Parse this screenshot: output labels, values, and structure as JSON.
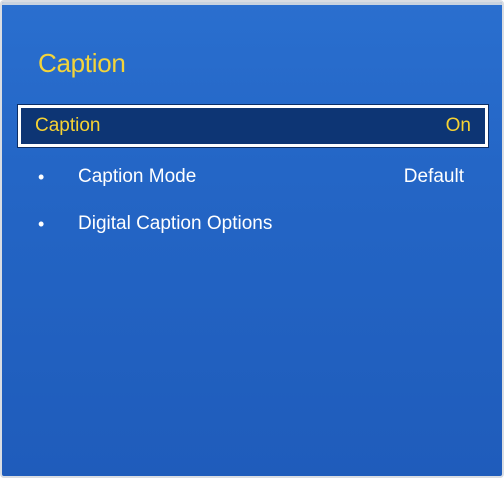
{
  "panel": {
    "title": "Caption"
  },
  "menu": {
    "items": [
      {
        "label": "Caption",
        "value": "On"
      },
      {
        "bullet": "•",
        "label": "Caption Mode",
        "value": "Default"
      },
      {
        "bullet": "•",
        "label": "Digital Caption Options",
        "value": ""
      }
    ]
  },
  "colors": {
    "background": "#2466c6",
    "title": "#f3d43a",
    "selected_background": "#0d3574",
    "selected_text": "#f6d233",
    "text": "#ffffff"
  }
}
